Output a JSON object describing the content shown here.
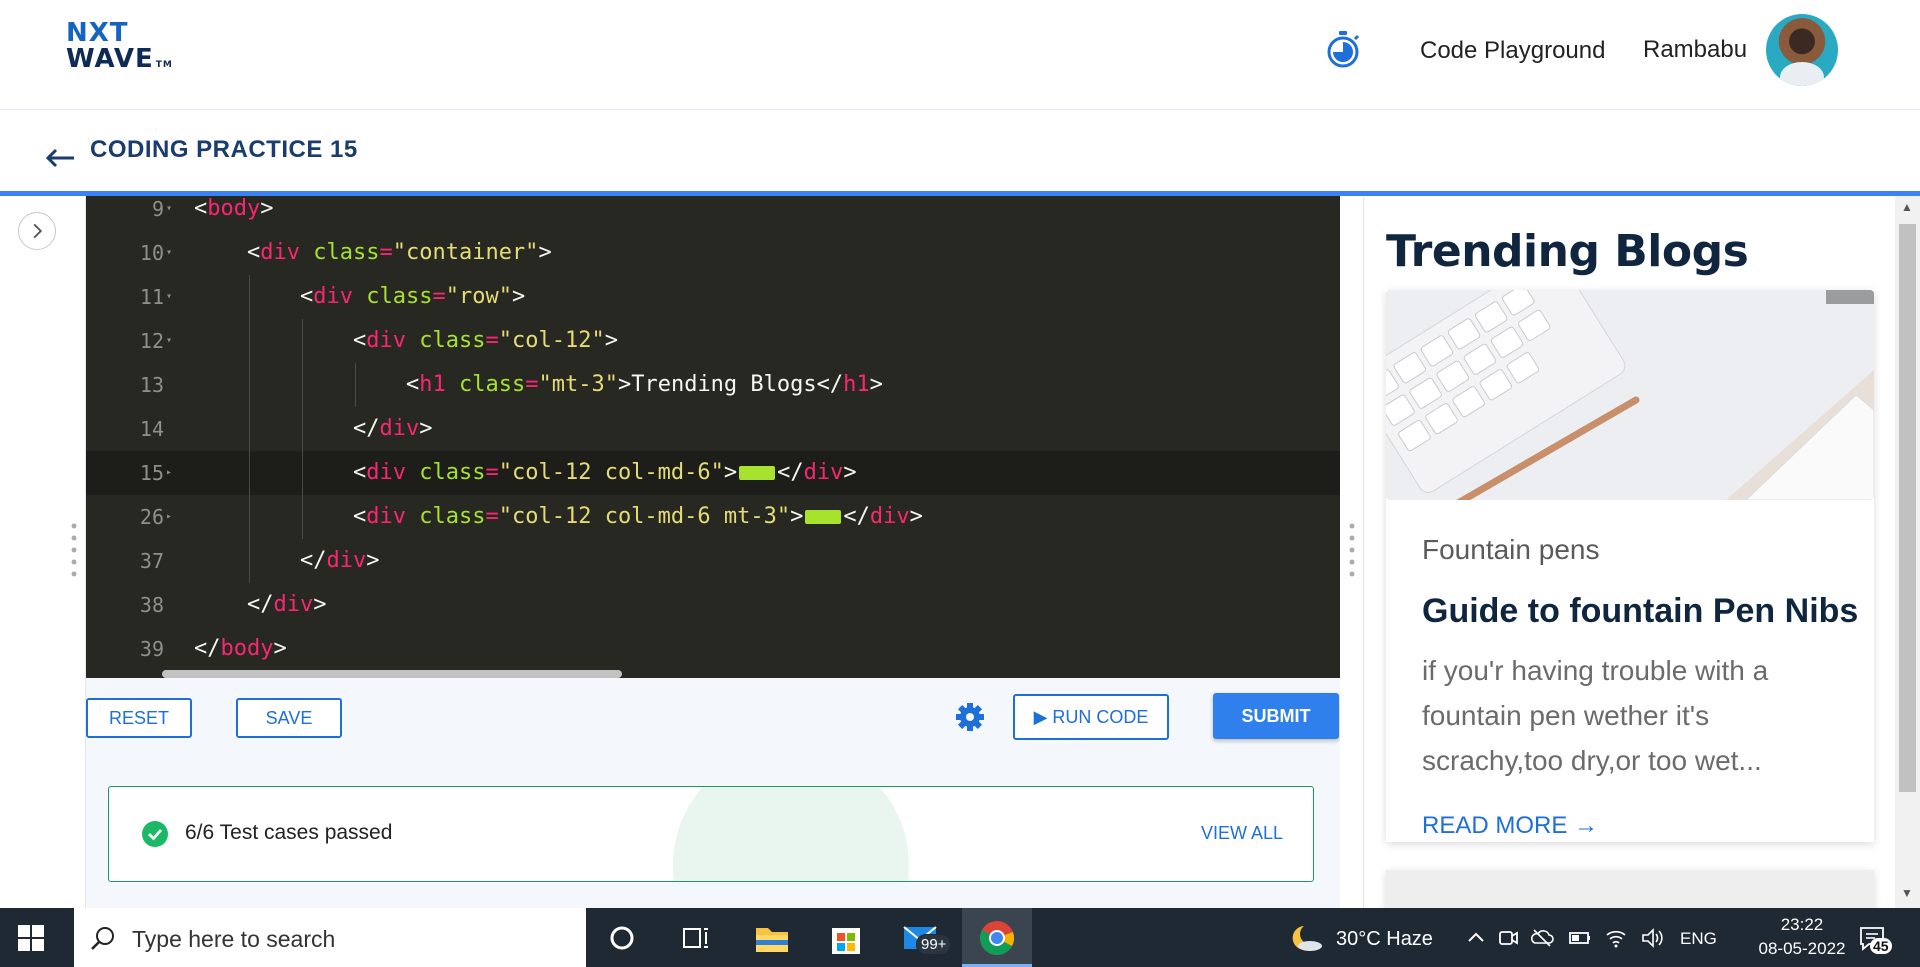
{
  "header": {
    "logo_line1": "NXT",
    "logo_line2": "WAVE",
    "logo_tm": "TM",
    "playground_label": "Code Playground",
    "username": "Rambabu"
  },
  "subheader": {
    "title": "CODING PRACTICE 15"
  },
  "editor": {
    "lines": [
      {
        "num": "9",
        "fold": "▾",
        "code": [
          {
            "c": "p",
            "t": "<"
          },
          {
            "c": "t",
            "t": "body"
          },
          {
            "c": "p",
            "t": ">"
          }
        ]
      },
      {
        "num": "10",
        "fold": "▾",
        "code": [
          {
            "c": "p",
            "t": "<"
          },
          {
            "c": "t",
            "t": "div"
          },
          {
            "c": "p",
            "t": " "
          },
          {
            "c": "a",
            "t": "class"
          },
          {
            "c": "t",
            "t": "="
          },
          {
            "c": "s",
            "t": "\"container\""
          },
          {
            "c": "p",
            "t": ">"
          }
        ]
      },
      {
        "num": "11",
        "fold": "▾",
        "code": [
          {
            "c": "p",
            "t": "<"
          },
          {
            "c": "t",
            "t": "div"
          },
          {
            "c": "p",
            "t": " "
          },
          {
            "c": "a",
            "t": "class"
          },
          {
            "c": "t",
            "t": "="
          },
          {
            "c": "s",
            "t": "\"row\""
          },
          {
            "c": "p",
            "t": ">"
          }
        ]
      },
      {
        "num": "12",
        "fold": "▾",
        "code": [
          {
            "c": "p",
            "t": "<"
          },
          {
            "c": "t",
            "t": "div"
          },
          {
            "c": "p",
            "t": " "
          },
          {
            "c": "a",
            "t": "class"
          },
          {
            "c": "t",
            "t": "="
          },
          {
            "c": "s",
            "t": "\"col-12\""
          },
          {
            "c": "p",
            "t": ">"
          }
        ]
      },
      {
        "num": "13",
        "fold": "",
        "code": [
          {
            "c": "p",
            "t": "<"
          },
          {
            "c": "t",
            "t": "h1"
          },
          {
            "c": "p",
            "t": " "
          },
          {
            "c": "a",
            "t": "class"
          },
          {
            "c": "t",
            "t": "="
          },
          {
            "c": "s",
            "t": "\"mt-3\""
          },
          {
            "c": "p",
            "t": ">Trending Blogs</"
          },
          {
            "c": "t",
            "t": "h1"
          },
          {
            "c": "p",
            "t": ">"
          }
        ]
      },
      {
        "num": "14",
        "fold": "",
        "code": [
          {
            "c": "p",
            "t": "</"
          },
          {
            "c": "t",
            "t": "div"
          },
          {
            "c": "p",
            "t": ">"
          }
        ]
      },
      {
        "num": "15",
        "fold": "▸",
        "code": [
          {
            "c": "p",
            "t": "<"
          },
          {
            "c": "t",
            "t": "div"
          },
          {
            "c": "p",
            "t": " "
          },
          {
            "c": "a",
            "t": "class"
          },
          {
            "c": "t",
            "t": "="
          },
          {
            "c": "s",
            "t": "\"col-12 col-md-6\""
          },
          {
            "c": "p",
            "t": ">"
          },
          {
            "c": "fm",
            "t": ""
          },
          {
            "c": "p",
            "t": "</"
          },
          {
            "c": "t",
            "t": "div"
          },
          {
            "c": "p",
            "t": ">"
          }
        ]
      },
      {
        "num": "26",
        "fold": "▸",
        "code": [
          {
            "c": "p",
            "t": "<"
          },
          {
            "c": "t",
            "t": "div"
          },
          {
            "c": "p",
            "t": " "
          },
          {
            "c": "a",
            "t": "class"
          },
          {
            "c": "t",
            "t": "="
          },
          {
            "c": "s",
            "t": "\"col-12 col-md-6 mt-3\""
          },
          {
            "c": "p",
            "t": ">"
          },
          {
            "c": "fm",
            "t": ""
          },
          {
            "c": "p",
            "t": "</"
          },
          {
            "c": "t",
            "t": "div"
          },
          {
            "c": "p",
            "t": ">"
          }
        ]
      },
      {
        "num": "37",
        "fold": "",
        "code": [
          {
            "c": "p",
            "t": "</"
          },
          {
            "c": "t",
            "t": "div"
          },
          {
            "c": "p",
            "t": ">"
          }
        ]
      },
      {
        "num": "38",
        "fold": "",
        "code": [
          {
            "c": "p",
            "t": "</"
          },
          {
            "c": "t",
            "t": "div"
          },
          {
            "c": "p",
            "t": ">"
          }
        ]
      },
      {
        "num": "39",
        "fold": "",
        "code": [
          {
            "c": "p",
            "t": "</"
          },
          {
            "c": "t",
            "t": "body"
          },
          {
            "c": "p",
            "t": ">"
          }
        ]
      }
    ],
    "active_line": "15",
    "colors": {
      "background": "#272822",
      "tag": "#f92672",
      "attr": "#a6e22e",
      "string": "#e6db74",
      "text": "#f8f8f2"
    }
  },
  "controls": {
    "reset_label": "RESET",
    "save_label": "SAVE",
    "run_label": "RUN CODE",
    "submit_label": "SUBMIT",
    "settings_icon": "gear-icon"
  },
  "results": {
    "summary": "6/6 Test cases passed",
    "view_all_label": "VIEW ALL",
    "status_color": "#1bb866"
  },
  "preview": {
    "heading": "Trending Blogs",
    "blog": {
      "category": "Fountain pens",
      "title": "Guide to fountain Pen Nibs",
      "description": "if you'r having trouble with a fountain pen wether it's scrachy,too dry,or too wet...",
      "read_more": "READ MORE →"
    }
  },
  "taskbar": {
    "search_placeholder": "Type here to search",
    "mail_badge": "99+",
    "weather": "30°C  Haze",
    "language": "ENG",
    "time": "23:22",
    "date": "08-05-2022",
    "notification_count": "45"
  },
  "colors": {
    "accent": "#1e6fd9",
    "submit_bg": "#2f80ed",
    "heading_navy": "#10263f",
    "success": "#1b9c5a"
  }
}
